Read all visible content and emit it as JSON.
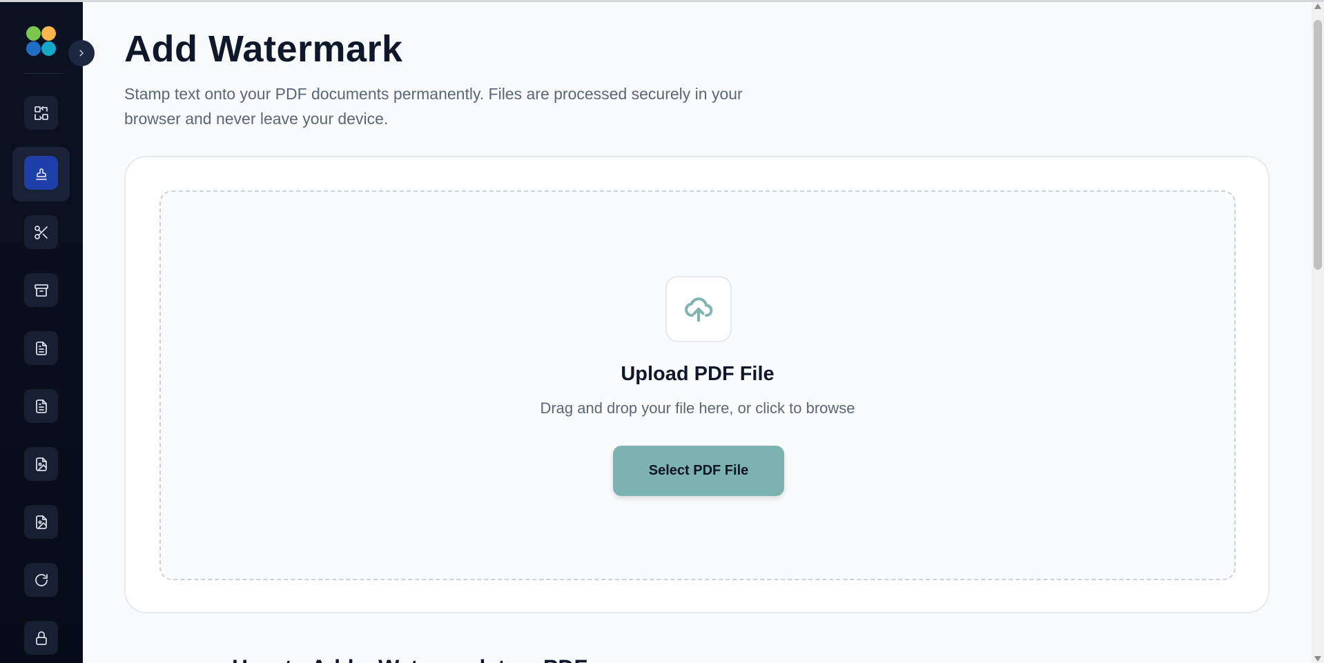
{
  "page": {
    "title": "Add Watermark",
    "description": "Stamp text onto your PDF documents permanently. Files are processed securely in your browser and never leave your device."
  },
  "upload": {
    "title": "Upload PDF File",
    "subtitle": "Drag and drop your file here, or click to browse",
    "button_label": "Select PDF File"
  },
  "next_section": {
    "heading": "How to Add a Watermark to a PDF"
  },
  "sidebar": {
    "items": [
      {
        "icon": "convert-icon"
      },
      {
        "icon": "stamp-icon",
        "active": true
      },
      {
        "icon": "scissors-icon"
      },
      {
        "icon": "archive-icon"
      },
      {
        "icon": "file-text-icon"
      },
      {
        "icon": "file-text-icon"
      },
      {
        "icon": "file-image-icon"
      },
      {
        "icon": "file-image-icon"
      },
      {
        "icon": "rotate-icon"
      },
      {
        "icon": "lock-icon"
      }
    ]
  },
  "colors": {
    "accent": "#7cb3b0",
    "active_nav": "#1e3fa8",
    "sidebar_bg": "#0b1222"
  }
}
